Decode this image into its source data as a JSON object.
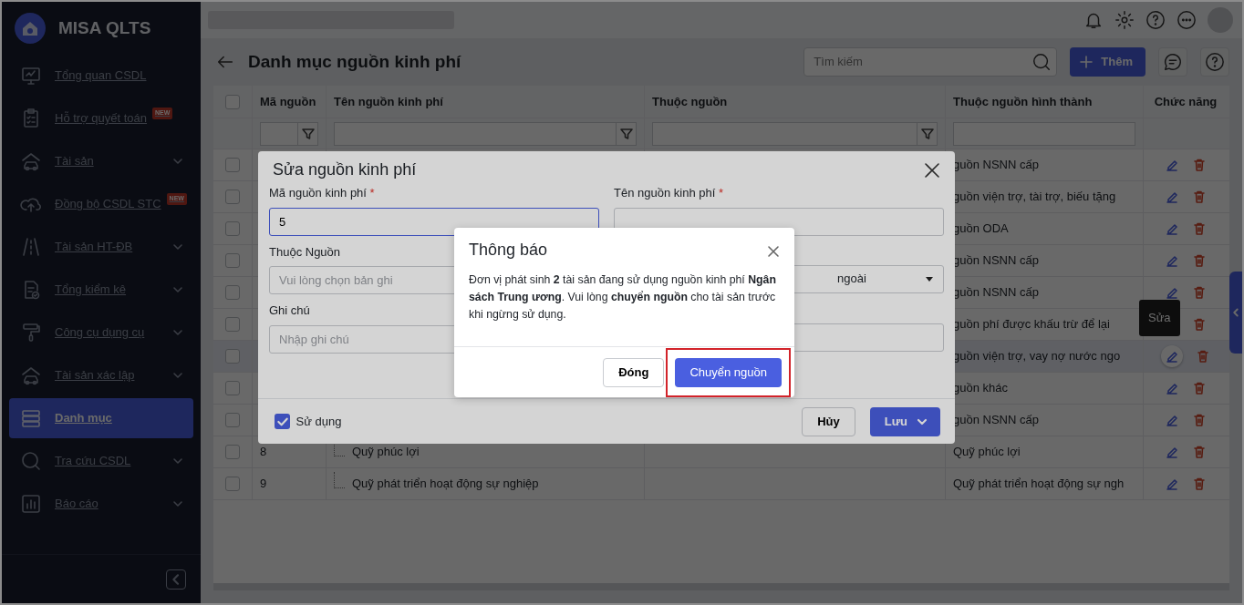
{
  "sidebar": {
    "brand": "MISA QLTS",
    "items": [
      {
        "label": "Tổng quan CSDL",
        "expandable": false,
        "selected": false
      },
      {
        "label": "Hỗ trợ quyết toán",
        "badge": "NEW",
        "expandable": false,
        "selected": false
      },
      {
        "label": "Tài sản",
        "expandable": true,
        "selected": false
      },
      {
        "label": "Đồng bộ CSDL STC",
        "badge": "NEW",
        "expandable": false,
        "selected": false
      },
      {
        "label": "Tài sản HT-ĐB",
        "expandable": true,
        "selected": false
      },
      {
        "label": "Tổng kiểm kê",
        "expandable": true,
        "selected": false
      },
      {
        "label": "Công cụ dụng cụ",
        "expandable": true,
        "selected": false
      },
      {
        "label": "Tài sản xác lập",
        "expandable": true,
        "selected": false
      },
      {
        "label": "Danh mục",
        "expandable": false,
        "selected": true
      },
      {
        "label": "Tra cứu CSDL",
        "expandable": true,
        "selected": false
      },
      {
        "label": "Báo cáo",
        "expandable": true,
        "selected": false
      }
    ]
  },
  "page": {
    "title": "Danh mục nguồn kinh phí",
    "search": {
      "placeholder": "Tìm kiếm"
    },
    "add_button": "Thêm"
  },
  "table": {
    "columns": [
      "Mã nguồn",
      "Tên nguồn kinh phí",
      "Thuộc nguồn",
      "Thuộc nguồn hình thành",
      "Chức năng"
    ],
    "tooltip": "Sửa",
    "rows": [
      {
        "formed_from": "guồn NSNN cấp",
        "checked": false,
        "highlighted": false
      },
      {
        "formed_from": "guồn viện trợ, tài trợ, biếu tặng",
        "checked": false,
        "highlighted": false
      },
      {
        "formed_from": "guồn ODA",
        "checked": false,
        "highlighted": false
      },
      {
        "formed_from": "guồn NSNN cấp",
        "checked": false,
        "highlighted": false
      },
      {
        "formed_from": "guồn NSNN cấp",
        "checked": false,
        "highlighted": false
      },
      {
        "formed_from": "guồn phí được khấu trừ để lại",
        "checked": false,
        "highlighted": false
      },
      {
        "formed_from": "guồn viện trợ, vay nợ nước ngo",
        "checked": false,
        "highlighted": true
      },
      {
        "formed_from": "guồn khác",
        "checked": false,
        "highlighted": false
      },
      {
        "formed_from": "guồn NSNN cấp",
        "checked": false,
        "highlighted": false
      },
      {
        "code": "8",
        "name": "Quỹ phúc lợi",
        "formed_from": "Quỹ phúc lợi",
        "checked": false,
        "highlighted": false
      },
      {
        "code": "9",
        "name": "Quỹ phát triển hoạt động sự nghiệp",
        "formed_from": "Quỹ phát triển hoạt động sự ngh",
        "checked": false,
        "highlighted": false
      }
    ],
    "select_all_checked": false
  },
  "edit_dialog": {
    "title": "Sửa nguồn kinh phí",
    "fields": [
      {
        "kind": "text",
        "label": "Mã nguồn kinh phí",
        "required_mark": "*",
        "value": "5",
        "focused": true
      },
      {
        "kind": "text",
        "label": "Tên nguồn kinh phí",
        "required_mark": "*",
        "focused": false
      },
      {
        "kind": "select",
        "label": "Thuộc Nguồn",
        "placeholder": "Vui lòng chọn bản ghi",
        "focused": false
      },
      {
        "kind": "select",
        "value": "ngoài",
        "focused": false
      },
      {
        "kind": "text",
        "label": "Ghi chú",
        "placeholder": "Nhập ghi chú",
        "focused": false
      },
      {
        "kind": "text",
        "focused": false
      }
    ],
    "use_checkbox": {
      "label": "Sử dụng",
      "checked": true
    },
    "cancel_button": "Hủy",
    "save_button": "Lưu"
  },
  "notice_dialog": {
    "title": "Thông báo",
    "message": "Đơn vị phát sinh **2** tài sản đang sử dụng nguồn kinh phí **Ngân sách Trung ương**. Vui lòng **chuyển nguồn** cho tài sản trước khi ngừng sử dụng.",
    "close_button": "Đóng",
    "transfer_button": "Chuyển nguồn"
  }
}
